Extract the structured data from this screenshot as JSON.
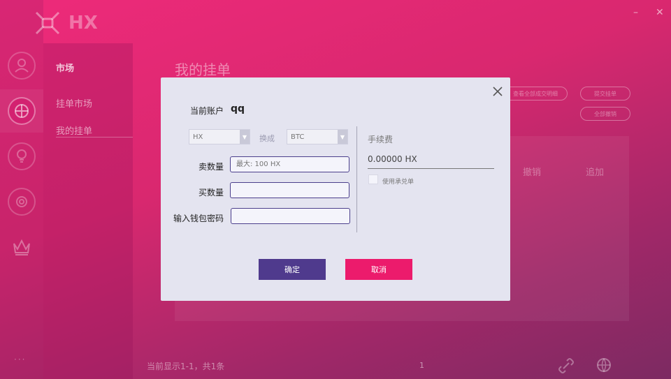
{
  "app": {
    "logo_text": "HX"
  },
  "window": {
    "minimize": "–",
    "close": "✕"
  },
  "nav": {
    "header": "市场",
    "items": [
      "挂单市场",
      "我的挂单"
    ]
  },
  "page": {
    "title": "我的挂单"
  },
  "toolbar": {
    "btn1": "查看全部成交明细",
    "btn2": "提交挂单",
    "btn3": "全部撤销"
  },
  "table": {
    "col_cancel": "撤销",
    "col_add": "追加"
  },
  "footer": {
    "status": "当前显示1-1，共1条",
    "page": "1"
  },
  "modal": {
    "account_label": "当前账户",
    "account_value": "qq",
    "from_asset": "HX",
    "swap_label": "换成",
    "to_asset": "BTC",
    "sell_label": "卖数量",
    "sell_placeholder": "最大: 100 HX",
    "buy_label": "买数量",
    "buy_value": "",
    "password_label": "输入钱包密码",
    "password_value": "",
    "fee_label": "手续费",
    "fee_value": "0.00000 HX",
    "acceptance_label": "使用承兑单",
    "confirm": "确定",
    "cancel": "取消"
  }
}
